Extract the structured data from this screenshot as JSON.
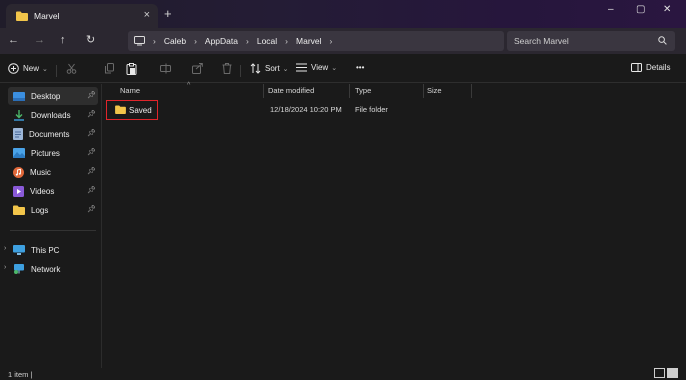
{
  "window": {
    "tab_title": "Marvel",
    "tab_close": "×",
    "new_tab": "+",
    "minimize": "–",
    "maximize": "▢",
    "close": "✕"
  },
  "nav": {
    "back": "←",
    "forward": "→",
    "up": "↑",
    "refresh": "↻",
    "breadcrumbs": [
      "Caleb",
      "AppData",
      "Local",
      "Marvel"
    ],
    "separator": "›"
  },
  "search": {
    "placeholder": "Search Marvel"
  },
  "commandbar": {
    "new_label": "New",
    "sort_label": "Sort",
    "view_label": "View",
    "more_label": "•••",
    "details_label": "Details"
  },
  "sidebar": {
    "items": [
      {
        "label": "Desktop",
        "icon": "desktop-icon",
        "pinned": true
      },
      {
        "label": "Downloads",
        "icon": "download-icon",
        "pinned": true
      },
      {
        "label": "Documents",
        "icon": "documents-icon",
        "pinned": true
      },
      {
        "label": "Pictures",
        "icon": "pictures-icon",
        "pinned": true
      },
      {
        "label": "Music",
        "icon": "music-icon",
        "pinned": true
      },
      {
        "label": "Videos",
        "icon": "videos-icon",
        "pinned": true
      },
      {
        "label": "Logs",
        "icon": "folder-icon",
        "pinned": true
      }
    ],
    "this_pc": "This PC",
    "network": "Network"
  },
  "list": {
    "columns": [
      "Name",
      "Date modified",
      "Type",
      "Size"
    ],
    "rows": [
      {
        "name": "Saved",
        "date_modified": "12/18/2024 10:20 PM",
        "type": "File folder",
        "size": ""
      }
    ]
  },
  "status": {
    "text": "1 item  |"
  },
  "colors": {
    "accent": "#e0252b",
    "folder": "#f2c54a",
    "desktop": "#3b8fe0"
  }
}
